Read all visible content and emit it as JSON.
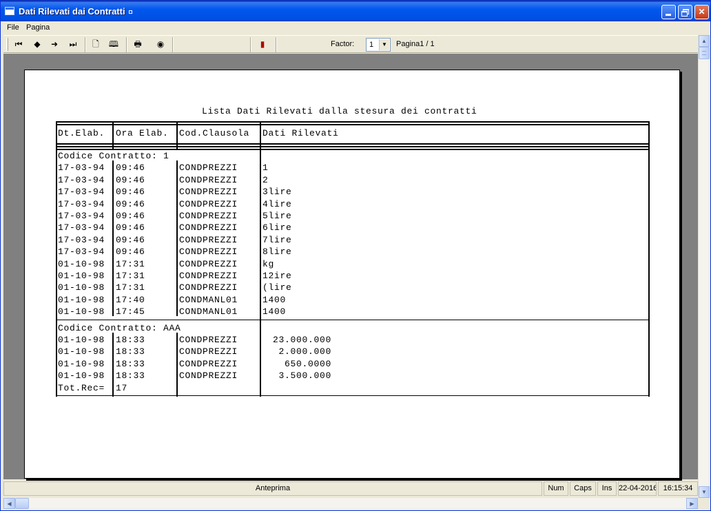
{
  "window": {
    "title": "Dati Rilevati dai Contratti"
  },
  "menu": {
    "items": [
      "File",
      "Pagina"
    ]
  },
  "toolbar": {
    "factor_label": "Factor:",
    "factor_value": "1",
    "page_label": "Pagina1 / 1",
    "icons": [
      "first-page-icon",
      "prev-page-icon",
      "next-page-icon",
      "last-page-icon",
      "single-page-icon",
      "two-pages-icon",
      "print-icon",
      "export-icon",
      "exit-door-icon"
    ]
  },
  "report": {
    "title": "Lista Dati Rilevati dalla stesura dei contratti",
    "headers": [
      "Dt.Elab.",
      "Ora Elab.",
      "Cod.Clausola",
      "Dati Rilevati"
    ],
    "groups": [
      {
        "label": "Codice Contratto: 1",
        "rows": [
          [
            "17-03-94",
            "09:46",
            "CONDPREZZI",
            "1"
          ],
          [
            "17-03-94",
            "09:46",
            "CONDPREZZI",
            "2"
          ],
          [
            "17-03-94",
            "09:46",
            "CONDPREZZI",
            "3lire"
          ],
          [
            "17-03-94",
            "09:46",
            "CONDPREZZI",
            "4lire"
          ],
          [
            "17-03-94",
            "09:46",
            "CONDPREZZI",
            "5lire"
          ],
          [
            "17-03-94",
            "09:46",
            "CONDPREZZI",
            "6lire"
          ],
          [
            "17-03-94",
            "09:46",
            "CONDPREZZI",
            "7lire"
          ],
          [
            "17-03-94",
            "09:46",
            "CONDPREZZI",
            "8lire"
          ],
          [
            "01-10-98",
            "17:31",
            "CONDPREZZI",
            "kg"
          ],
          [
            "01-10-98",
            "17:31",
            "CONDPREZZI",
            "12ire"
          ],
          [
            "01-10-98",
            "17:31",
            "CONDPREZZI",
            "(lire"
          ],
          [
            "01-10-98",
            "17:40",
            "CONDMANL01",
            "1400"
          ],
          [
            "01-10-98",
            "17:45",
            "CONDMANL01",
            "1400"
          ]
        ]
      },
      {
        "label": "Codice Contratto: AAA",
        "rows": [
          [
            "01-10-98",
            "18:33",
            "CONDPREZZI",
            "23.000.000"
          ],
          [
            "01-10-98",
            "18:33",
            "CONDPREZZI",
            "2.000.000"
          ],
          [
            "01-10-98",
            "18:33",
            "CONDPREZZI",
            "650.0000"
          ],
          [
            "01-10-98",
            "18:33",
            "CONDPREZZI",
            "3.500.000"
          ]
        ]
      }
    ],
    "total_label": "Tot.Rec=",
    "total_value": "17"
  },
  "statusbar": {
    "main": "Anteprima",
    "num": "Num",
    "caps": "Caps",
    "ins": "Ins",
    "date": "22-04-2016",
    "time": "16:15:34"
  }
}
